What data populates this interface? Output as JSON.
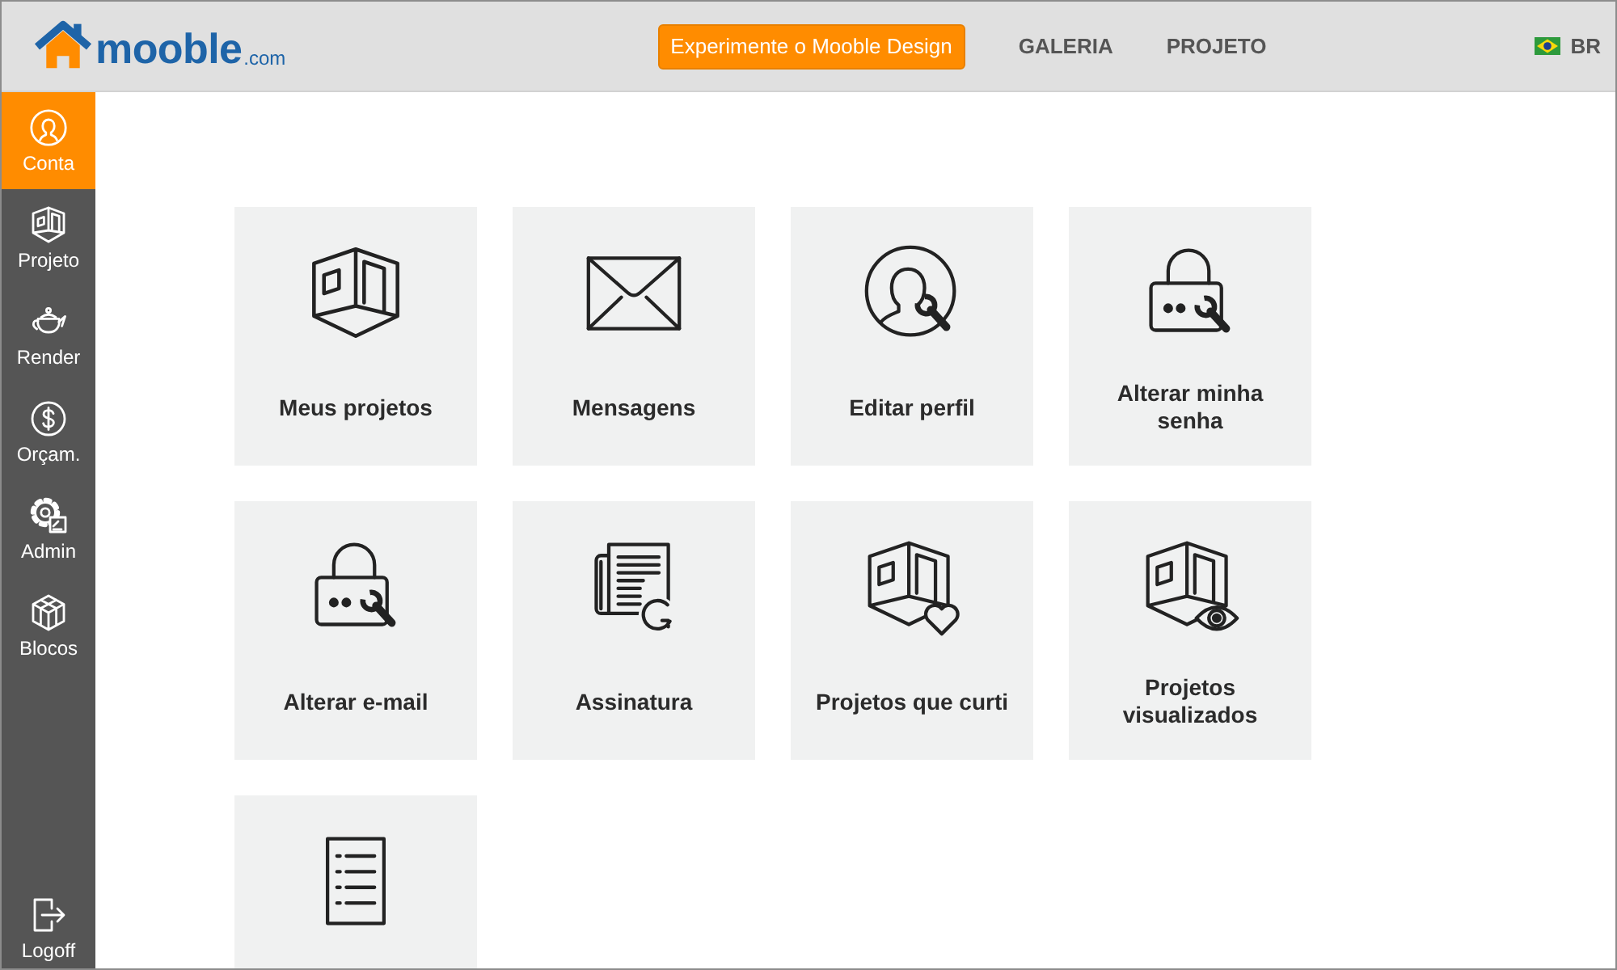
{
  "header": {
    "logo": {
      "name": "mooble",
      "suffix": ".com"
    },
    "cta_button": "Experimente o Mooble Design",
    "nav": [
      "GALERIA",
      "PROJETO"
    ],
    "language": "BR"
  },
  "sidebar": {
    "items": [
      {
        "label": "Conta",
        "kind": "user",
        "selected": true
      },
      {
        "label": "Projeto",
        "kind": "room",
        "selected": false
      },
      {
        "label": "Render",
        "kind": "teapot",
        "selected": false
      },
      {
        "label": "Orçam.",
        "kind": "dollar",
        "selected": false
      },
      {
        "label": "Admin",
        "kind": "gear",
        "selected": false
      },
      {
        "label": "Blocos",
        "kind": "cube",
        "selected": false
      }
    ],
    "footer_item": {
      "label": "Logoff",
      "kind": "logout"
    }
  },
  "tiles": [
    {
      "label": "Meus projetos",
      "kind": "room"
    },
    {
      "label": "Mensagens",
      "kind": "envelope"
    },
    {
      "label": "Editar perfil",
      "kind": "user-wrench"
    },
    {
      "label": "Alterar minha senha",
      "kind": "lock-wrench"
    },
    {
      "label": "Alterar e-mail",
      "kind": "lock-wrench"
    },
    {
      "label": "Assinatura",
      "kind": "newspaper"
    },
    {
      "label": "Projetos que curti",
      "kind": "room-heart"
    },
    {
      "label": "Projetos visualizados",
      "kind": "room-eye"
    },
    {
      "kind": "list"
    }
  ]
}
